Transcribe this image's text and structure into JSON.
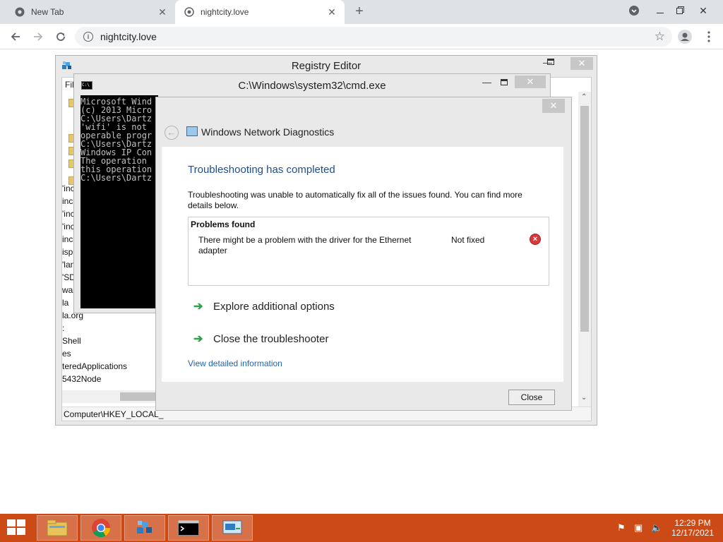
{
  "browser": {
    "tabs": [
      {
        "label": "New Tab",
        "icon": "chrome-icon",
        "active": false
      },
      {
        "label": "nightcity.love",
        "icon": "globe-icon",
        "active": true
      }
    ],
    "new_tab_symbol": "+",
    "close_symbol": "✕",
    "url": "nightcity.love"
  },
  "registry": {
    "title": "Registry Editor",
    "menu_fragment": "Fil",
    "tree_fragments": [
      "'inc",
      "inc",
      "'inc",
      "'inc",
      "inc",
      "isp",
      "'lan",
      "'SD.",
      "wa",
      "la",
      "la.org",
      ":",
      "Shell",
      "es",
      "teredApplications",
      "5432Node"
    ],
    "status_path": "Computer\\HKEY_LOCAL_"
  },
  "cmd": {
    "title": "C:\\Windows\\system32\\cmd.exe",
    "lines": [
      "Microsoft Wind",
      "(c) 2013 Micro",
      "",
      "C:\\Users\\Dartz",
      "'wifi' is not ",
      "operable progr",
      "",
      "C:\\Users\\Dartz",
      "",
      "Windows IP Con",
      "",
      "The operation ",
      "this operation",
      "",
      "C:\\Users\\Dartz"
    ]
  },
  "diagnostics": {
    "app_title": "Windows Network Diagnostics",
    "heading": "Troubleshooting has completed",
    "description": "Troubleshooting was unable to automatically fix all of the issues found. You can find more details below.",
    "problems_header": "Problems found",
    "problem": {
      "text": "There might be a problem with the driver for the Ethernet adapter",
      "status": "Not fixed"
    },
    "options": [
      "Explore additional options",
      "Close the troubleshooter"
    ],
    "detail_link": "View detailed information",
    "close_button": "Close"
  },
  "taskbar": {
    "time": "12:29 PM",
    "date": "12/17/2021",
    "pinned": [
      "file-explorer-icon",
      "chrome-icon",
      "registry-editor-icon",
      "cmd-icon",
      "network-diagnostics-icon"
    ]
  }
}
